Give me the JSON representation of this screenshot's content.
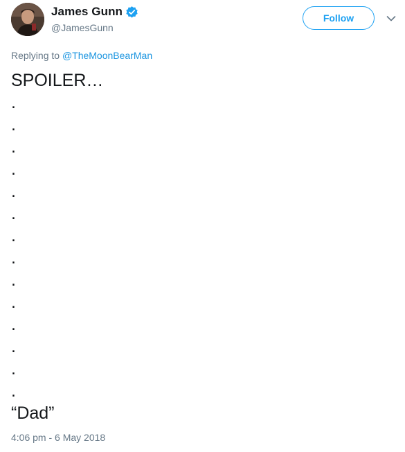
{
  "author": {
    "name": "James Gunn",
    "handle": "@JamesGunn",
    "verified_icon": "verified-badge-icon",
    "verified_color": "#1da1f2"
  },
  "actions": {
    "follow_label": "Follow",
    "more_icon": "chevron-down-icon"
  },
  "reply": {
    "prefix": "Replying to",
    "mention": "@TheMoonBearMan"
  },
  "tweet": {
    "lines": [
      "SPOILER…",
      ".",
      ".",
      ".",
      ".",
      ".",
      ".",
      ".",
      ".",
      ".",
      ".",
      ".",
      ".",
      ".",
      ".",
      "“Dad”"
    ]
  },
  "timestamp": "4:06 pm - 6 May 2018",
  "colors": {
    "accent": "#1da1f2",
    "link": "#1b95e0",
    "secondary_text": "#657786",
    "primary_text": "#14171a"
  }
}
